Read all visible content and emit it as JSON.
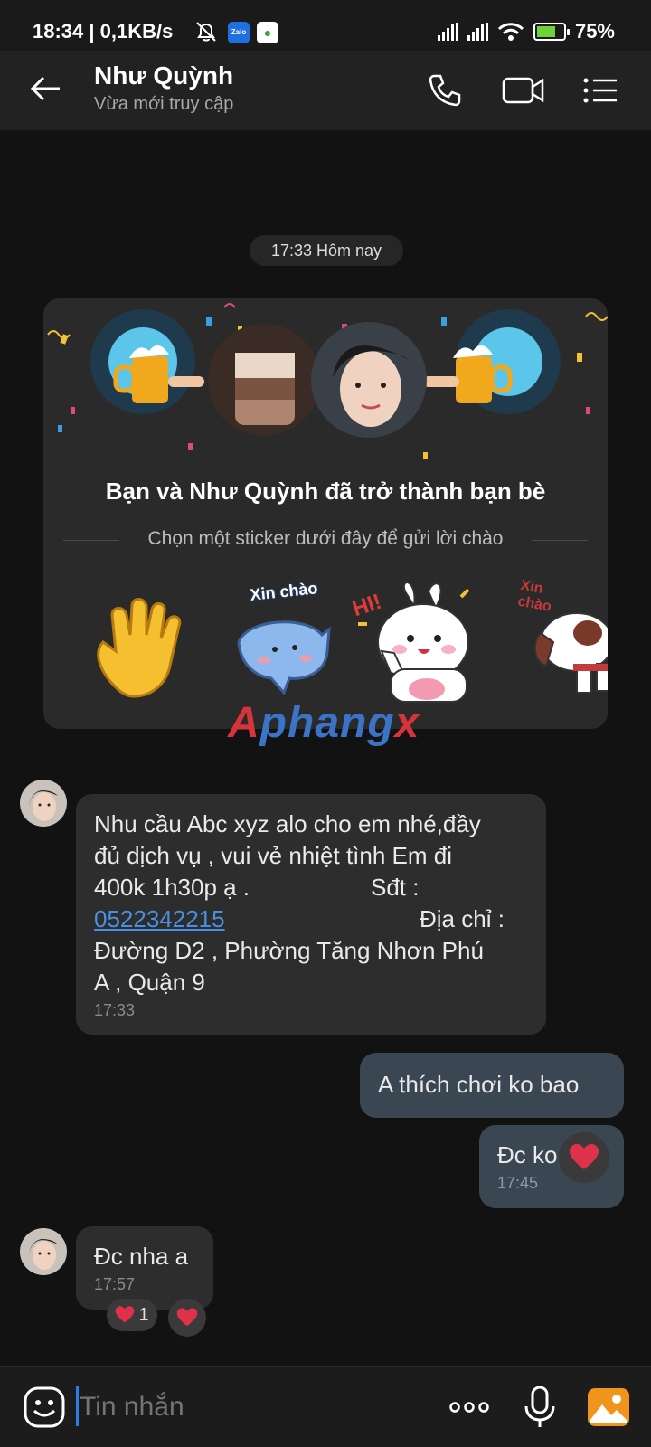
{
  "status_bar": {
    "time": "18:34",
    "speed": "| 0,1KB/s",
    "battery_pct": "75%",
    "battery_level": 0.75,
    "icons": [
      "mute-bell-icon",
      "zalo-icon",
      "app-icon",
      "signal-icon",
      "signal-icon",
      "wifi-icon",
      "battery-charging-icon"
    ]
  },
  "header": {
    "name": "Như Quỳnh",
    "status": "Vừa mới truy cập",
    "icons": [
      "back-arrow-icon",
      "phone-icon",
      "video-icon",
      "menu-list-icon"
    ]
  },
  "chat": {
    "date_chip": "17:33 Hôm nay",
    "friend_card": {
      "title": "Bạn và Như Quỳnh đã trở thành bạn bè",
      "subtitle": "Chọn một sticker dưới đây để gửi lời chào",
      "sticker_text_1": "Xin chào",
      "sticker_text_2": "HI!",
      "sticker_text_3": "Xin chào"
    },
    "watermark": {
      "a": "A",
      "b": "phang",
      "c": "x"
    },
    "messages": [
      {
        "line1": "Nhu cầu Abc xyz alo cho em nhé,đầy",
        "line2": "đủ dịch vụ , vui vẻ nhiệt tình  Em đi",
        "line3_a": "400k 1h30p ạ .",
        "line3_b": "Sđt :",
        "phone": "0522342215",
        "addr_label": "Địa chỉ :",
        "line5": "Đường D2 , Phường Tăng Nhơn Phú",
        "line6": "A , Quận 9",
        "time": "17:33"
      },
      {
        "text": "A thích chơi ko bao"
      },
      {
        "text": "Đc ko em",
        "time": "17:45"
      },
      {
        "text": "Đc nha a",
        "time": "17:57",
        "reaction_count": "1"
      }
    ],
    "heart_color": "#e0314b"
  },
  "input": {
    "placeholder": "Tin nhắn",
    "icons": [
      "emoji-icon",
      "more-dots-icon",
      "microphone-icon",
      "image-icon"
    ]
  }
}
